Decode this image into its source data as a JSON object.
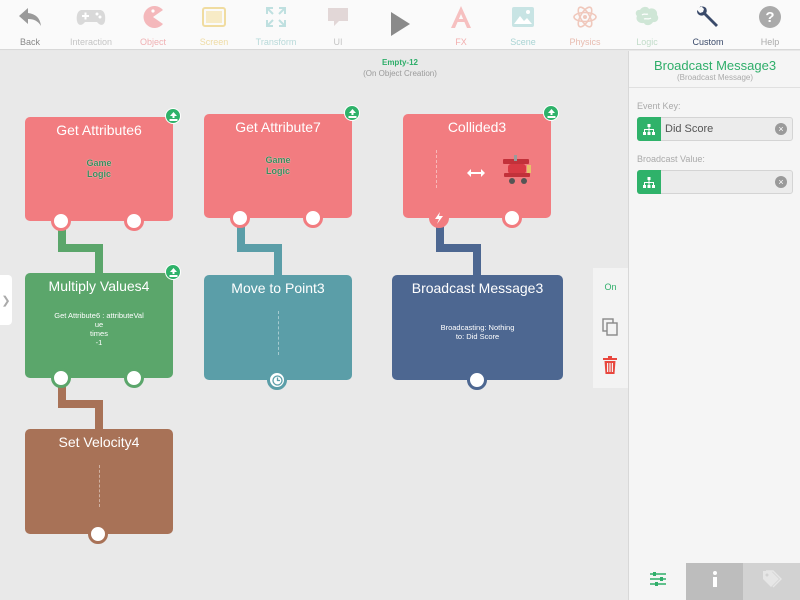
{
  "toolbar": {
    "items": [
      {
        "label": "Back",
        "icon": "back-arrow-icon"
      },
      {
        "label": "Interaction",
        "icon": "gamepad-icon"
      },
      {
        "label": "Object",
        "icon": "pacman-icon"
      },
      {
        "label": "Screen",
        "icon": "screen-icon"
      },
      {
        "label": "Transform",
        "icon": "transform-icon"
      },
      {
        "label": "UI",
        "icon": "speech-bubble-icon"
      },
      {
        "label": "",
        "icon": "play-icon"
      },
      {
        "label": "FX",
        "icon": "fx-icon"
      },
      {
        "label": "Scene",
        "icon": "scene-image-icon"
      },
      {
        "label": "Physics",
        "icon": "atom-icon"
      },
      {
        "label": "Logic",
        "icon": "brain-icon"
      },
      {
        "label": "Custom",
        "icon": "wrench-icon"
      },
      {
        "label": "Help",
        "icon": "help-icon"
      }
    ]
  },
  "scene": {
    "title": "Empty-12",
    "subtitle": "(On Object Creation)"
  },
  "blocks": {
    "get_attribute6": {
      "title": "Get Attribute6",
      "logic_line1": "Game",
      "logic_line2": "Logic"
    },
    "get_attribute7": {
      "title": "Get Attribute7",
      "logic_line1": "Game",
      "logic_line2": "Logic"
    },
    "collided3": {
      "title": "Collided3"
    },
    "multiply_values4": {
      "title": "Multiply Values4",
      "line1": "Get Attribute6 : attributeVal",
      "line2": "ue",
      "line3": "times",
      "line4": "-1"
    },
    "move_to_point3": {
      "title": "Move to Point3"
    },
    "broadcast_message3": {
      "title": "Broadcast Message3",
      "line1": "Broadcasting: Nothing",
      "line2": "to: Did Score"
    },
    "set_velocity4": {
      "title": "Set Velocity4"
    }
  },
  "side_tools": {
    "on_label": "On"
  },
  "panel": {
    "title": "Broadcast Message3",
    "subtitle": "(Broadcast Message)",
    "event_key_label": "Event Key:",
    "event_key_value": "Did Score",
    "broadcast_value_label": "Broadcast Value:",
    "broadcast_value": ""
  },
  "colors": {
    "pink": "#f27c80",
    "green": "#5ba66b",
    "teal": "#5b9ea8",
    "navy": "#4d6791",
    "brown": "#a87257",
    "accent": "#2fae6a"
  }
}
